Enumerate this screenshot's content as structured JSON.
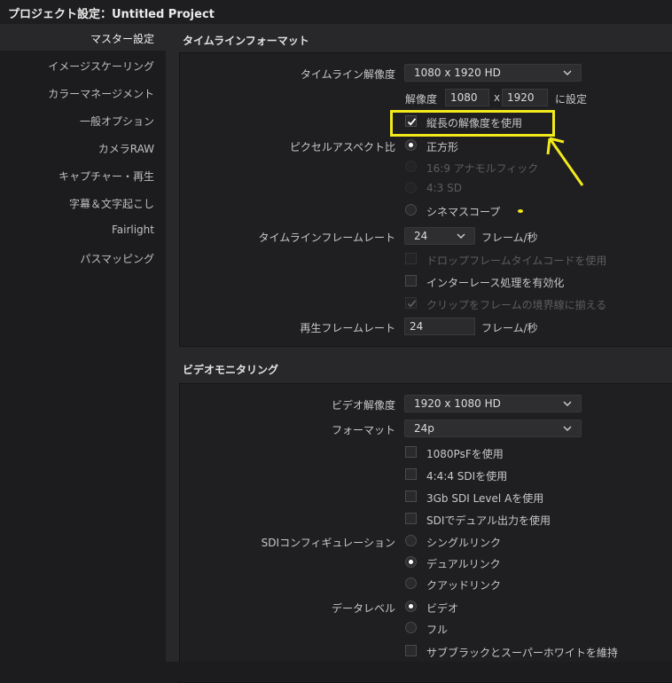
{
  "title": "プロジェクト設定：Untitled Project",
  "sidebar": {
    "items": [
      {
        "label": "マスター設定",
        "active": true
      },
      {
        "label": "イメージスケーリング"
      },
      {
        "label": "カラーマネージメント"
      },
      {
        "label": "一般オプション"
      },
      {
        "label": "カメラRAW"
      },
      {
        "label": "キャプチャー・再生"
      },
      {
        "label": "字幕＆文字起こし"
      },
      {
        "label": "Fairlight"
      },
      {
        "label": "パスマッピング"
      }
    ]
  },
  "timeline_format": {
    "title": "タイムラインフォーマット",
    "resolution_label": "タイムライン解像度",
    "resolution_value": "1080 x 1920 HD",
    "custom_label": "解像度",
    "width": "1080",
    "x_sep": "x",
    "height": "1920",
    "set_label": "に設定",
    "vertical_label": "縦長の解像度を使用",
    "pixel_aspect_label": "ピクセルアスペクト比",
    "aspect_options": [
      "正方形",
      "16:9 アナモルフィック",
      "4:3 SD",
      "シネマスコープ"
    ],
    "frame_rate_label": "タイムラインフレームレート",
    "frame_rate_value": "24",
    "frame_rate_unit": "フレーム/秒",
    "drop_frame_label": "ドロップフレームタイムコードを使用",
    "interlace_label": "インターレース処理を有効化",
    "clip_snap_label": "クリップをフレームの境界線に揃える",
    "playback_rate_label": "再生フレームレート",
    "playback_rate_value": "24",
    "playback_rate_unit": "フレーム/秒"
  },
  "video_monitoring": {
    "title": "ビデオモニタリング",
    "resolution_label": "ビデオ解像度",
    "resolution_value": "1920 x 1080 HD",
    "format_label": "フォーマット",
    "format_value": "24p",
    "options": [
      "1080PsFを使用",
      "4:4:4 SDIを使用",
      "3Gb SDI Level Aを使用",
      "SDIでデュアル出力を使用"
    ],
    "sdi_config_label": "SDIコンフィギュレーション",
    "sdi_options": [
      "シングルリンク",
      "デュアルリンク",
      "クアッドリンク"
    ],
    "data_level_label": "データレベル",
    "data_level_options": [
      "ビデオ",
      "フル"
    ],
    "retain_label": "サブブラックとスーパーホワイトを維持"
  },
  "colors": {
    "highlight": "#f2ea1a",
    "panel_bg": "#1f1f22",
    "main_bg": "#28282b"
  },
  "icons": [
    "chevron-down-icon",
    "checkmark-icon",
    "arrow-annotation-icon"
  ]
}
